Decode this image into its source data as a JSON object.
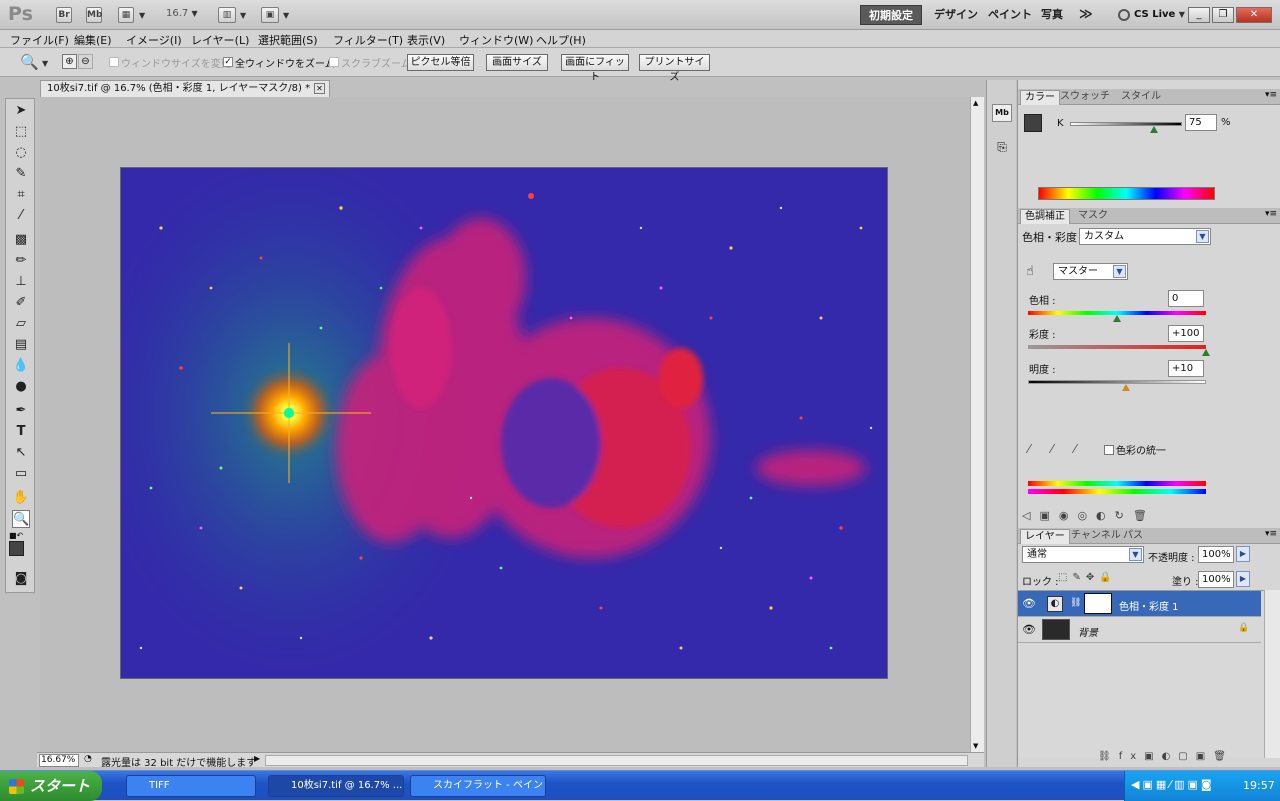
{
  "app": {
    "logo": "Ps",
    "bridge": "Br",
    "minibridge": "Mb",
    "zoom": "16.7"
  },
  "workspaces": [
    "初期設定",
    "デザイン",
    "ペイント",
    "写真",
    "≫"
  ],
  "cslive": "CS Live",
  "menu": [
    "ファイル(F)",
    "編集(E)",
    "イメージ(I)",
    "レイヤー(L)",
    "選択範囲(S)",
    "フィルター(T)",
    "表示(V)",
    "ウィンドウ(W)",
    "ヘルプ(H)"
  ],
  "options": {
    "resize_windows": "ウィンドウサイズを変更",
    "zoom_all": "全ウィンドウをズーム",
    "scrubby": "スクラブズーム",
    "actual_pixels": "ピクセル等倍",
    "fit_screen": "画面サイズ",
    "fill_screen": "画面にフィット",
    "print_size": "プリントサイズ"
  },
  "document": {
    "tab_title": "10枚si7.tif @ 16.7% (色相・彩度 1, レイヤーマスク/8) *"
  },
  "status": {
    "zoom": "16.67%",
    "message": "露光量は 32 bit だけで機能します"
  },
  "color_panel": {
    "tabs": [
      "カラー",
      "スウォッチ",
      "スタイル"
    ],
    "channel": "K",
    "value": "75",
    "unit": "%",
    "k_level": 0.75
  },
  "adjust_panel": {
    "tabs": [
      "色調補正",
      "マスク"
    ],
    "title": "色相・彩度",
    "preset": "カスタム",
    "range": "マスター",
    "hue_label": "色相 :",
    "hue": "0",
    "sat_label": "彩度 :",
    "sat": "+100",
    "light_label": "明度 :",
    "light": "+10",
    "colorize": "色彩の統一"
  },
  "layers_panel": {
    "tabs": [
      "レイヤー",
      "チャンネル",
      "パス"
    ],
    "blend": "通常",
    "opacity_label": "不透明度 :",
    "opacity": "100%",
    "lock_label": "ロック :",
    "fill_label": "塗り :",
    "fill": "100%",
    "layers": [
      {
        "name": "色相・彩度 1",
        "selected": true
      },
      {
        "name": "背景",
        "selected": false
      }
    ]
  },
  "taskbar": {
    "start": "スタート",
    "tasks": [
      "TIFF",
      "10枚si7.tif @ 16.7% ...",
      "スカイフラット - ペイント"
    ],
    "clock": "19:57"
  }
}
